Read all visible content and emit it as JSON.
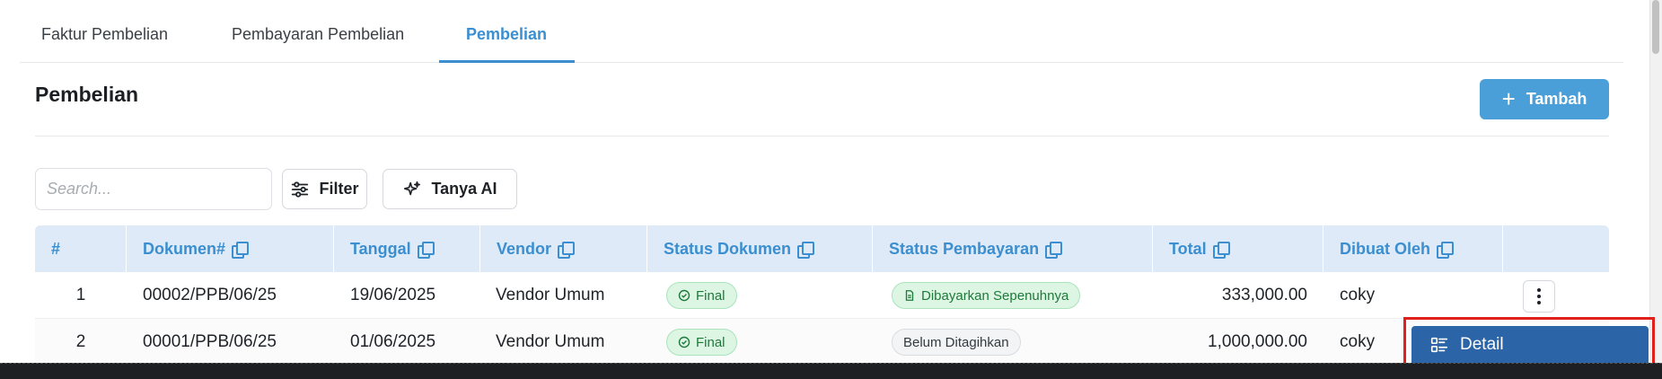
{
  "tabs": [
    {
      "label": "Faktur Pembelian",
      "active": false
    },
    {
      "label": "Pembayaran Pembelian",
      "active": false
    },
    {
      "label": "Pembelian",
      "active": true
    }
  ],
  "page": {
    "title": "Pembelian",
    "add_label": "Tambah"
  },
  "toolbar": {
    "search_placeholder": "Search...",
    "filter_label": "Filter",
    "ai_label": "Tanya AI"
  },
  "table": {
    "columns": [
      "#",
      "Dokumen#",
      "Tanggal",
      "Vendor",
      "Status Dokumen",
      "Status Pembayaran",
      "Total",
      "Dibuat Oleh"
    ],
    "rows": [
      {
        "no": "1",
        "dokumen": "00002/PPB/06/25",
        "tanggal": "19/06/2025",
        "vendor": "Vendor Umum",
        "status_dokumen": "Final",
        "status_pembayaran": "Dibayarkan Sepenuhnya",
        "total": "333,000.00",
        "dibuat_oleh": "coky"
      },
      {
        "no": "2",
        "dokumen": "00001/PPB/06/25",
        "tanggal": "01/06/2025",
        "vendor": "Vendor Umum",
        "status_dokumen": "Final",
        "status_pembayaran": "Belum Ditagihkan",
        "total": "1,000,000.00",
        "dibuat_oleh": "coky"
      }
    ]
  },
  "context_menu": {
    "detail_label": "Detail"
  },
  "colors": {
    "accent": "#3b8fd0",
    "primary_button": "#4a9fd8",
    "menu_bg": "#2b65a8",
    "success_badge": "#dcf6e3",
    "highlight": "#e0201d"
  },
  "icons": [
    "plus-icon",
    "filter-sliders-icon",
    "sparkle-icon",
    "copy-icon",
    "check-circle-icon",
    "document-icon",
    "kebab-icon",
    "list-detail-icon"
  ]
}
